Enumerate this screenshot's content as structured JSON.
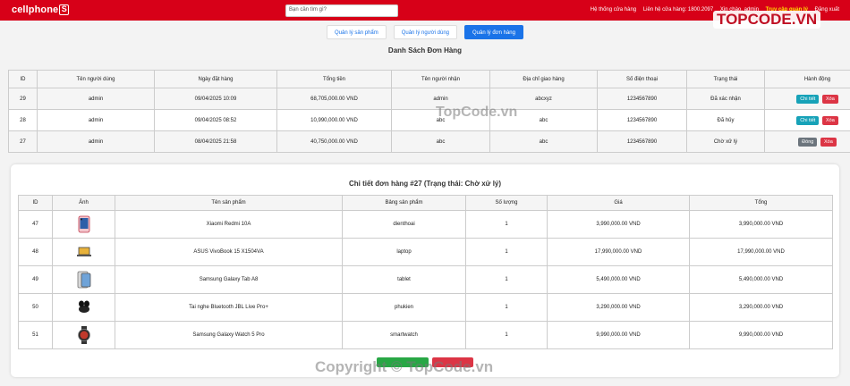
{
  "header": {
    "logo_text": "cellphone",
    "logo_box": "S",
    "search_placeholder": "Bạn cần tìm gì?",
    "links": [
      "Hệ thống cửa hàng",
      "Liên hệ cửa hàng: 1800.2097",
      "Xin chào, admin",
      "Truy cập quản lý",
      "Đăng xuất"
    ],
    "brand_color": "#d70018"
  },
  "tabs": [
    {
      "label": "Quản lý sản phẩm",
      "active": false
    },
    {
      "label": "Quản lý người dùng",
      "active": false
    },
    {
      "label": "Quản lý đơn hàng",
      "active": true
    }
  ],
  "orders": {
    "title": "Danh Sách Đơn Hàng",
    "columns": [
      "ID",
      "Tên người dùng",
      "Ngày đặt hàng",
      "Tổng tiền",
      "Tên người nhận",
      "Địa chỉ giao hàng",
      "Số điện thoại",
      "Trạng thái",
      "Hành động"
    ],
    "rows": [
      {
        "id": "29",
        "user": "admin",
        "date": "09/04/2025 10:09",
        "total": "68,705,000.00 VND",
        "receiver": "admin",
        "address": "abcxyz",
        "phone": "1234567890",
        "status": "Đã xác nhận",
        "actions": [
          {
            "label": "Chi tiết",
            "style": "info"
          },
          {
            "label": "Xóa",
            "style": "danger"
          }
        ]
      },
      {
        "id": "28",
        "user": "admin",
        "date": "09/04/2025 08:52",
        "total": "10,990,000.00 VND",
        "receiver": "abc",
        "address": "abc",
        "phone": "1234567890",
        "status": "Đã hủy",
        "actions": [
          {
            "label": "Chi tiết",
            "style": "info"
          },
          {
            "label": "Xóa",
            "style": "danger"
          }
        ]
      },
      {
        "id": "27",
        "user": "admin",
        "date": "08/04/2025 21:58",
        "total": "40,750,000.00 VND",
        "receiver": "abc",
        "address": "abc",
        "phone": "1234567890",
        "status": "Chờ xử lý",
        "actions": [
          {
            "label": "Đóng",
            "style": "gray"
          },
          {
            "label": "Xóa",
            "style": "danger"
          }
        ]
      }
    ]
  },
  "detail": {
    "title": "Chi tiết đơn hàng #27 (Trạng thái: Chờ xử lý)",
    "columns": [
      "ID",
      "Ảnh",
      "Tên sản phẩm",
      "Bảng sản phẩm",
      "Số lượng",
      "Giá",
      "Tổng"
    ],
    "items": [
      {
        "id": "47",
        "image": "phone-icon",
        "name": "Xiaomi Redmi 10A",
        "table": "dienthoai",
        "qty": "1",
        "price": "3,990,000.00 VND",
        "total": "3,990,000.00 VND"
      },
      {
        "id": "48",
        "image": "laptop-icon",
        "name": "ASUS VivoBook 15 X1504VA",
        "table": "laptop",
        "qty": "1",
        "price": "17,990,000.00 VND",
        "total": "17,990,000.00 VND"
      },
      {
        "id": "49",
        "image": "tablet-icon",
        "name": "Samsung Galaxy Tab A8",
        "table": "tablet",
        "qty": "1",
        "price": "5,490,000.00 VND",
        "total": "5,490,000.00 VND"
      },
      {
        "id": "50",
        "image": "earbuds-icon",
        "name": "Tai nghe Bluetooth JBL Live Pro+",
        "table": "phukien",
        "qty": "1",
        "price": "3,290,000.00 VND",
        "total": "3,290,000.00 VND"
      },
      {
        "id": "51",
        "image": "watch-icon",
        "name": "Samsung Galaxy Watch 5 Pro",
        "table": "smartwatch",
        "qty": "1",
        "price": "9,990,000.00 VND",
        "total": "9,990,000.00 VND"
      }
    ]
  },
  "watermarks": {
    "corner": "TOPCODE.VN",
    "middle": "TopCode.vn",
    "footer": "Copyright © TopCode.vn"
  }
}
